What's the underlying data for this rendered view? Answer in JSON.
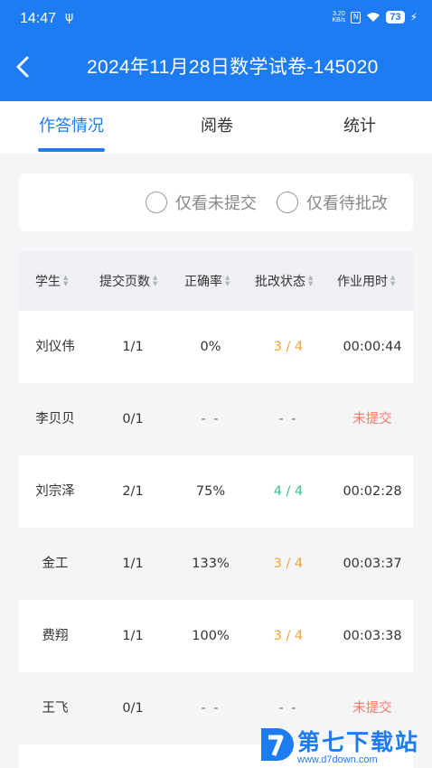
{
  "status_bar": {
    "time": "14:47",
    "usb_icon": "usb-icon",
    "net_speed_value": "3.20",
    "net_speed_unit": "KB/s",
    "battery": "73"
  },
  "header": {
    "title": "2024年11月28日数学试卷-145020",
    "background": "#1e7cf2"
  },
  "tabs": [
    {
      "label": "作答情况",
      "active": true
    },
    {
      "label": "阅卷",
      "active": false
    },
    {
      "label": "统计",
      "active": false
    }
  ],
  "filters": {
    "not_submitted": "仅看未提交",
    "pending_review": "仅看待批改"
  },
  "table": {
    "headers": [
      "学生",
      "提交页数",
      "正确率",
      "批改状态",
      "作业用时"
    ],
    "rows": [
      {
        "student": "刘仪伟",
        "pages": "1/1",
        "accuracy": "0%",
        "status": "3 / 4",
        "status_color": "orange",
        "time": "00:00:44",
        "time_color": "normal"
      },
      {
        "student": "李贝贝",
        "pages": "0/1",
        "accuracy": "- -",
        "status": "- -",
        "status_color": "dash",
        "time": "未提交",
        "time_color": "red"
      },
      {
        "student": "刘宗泽",
        "pages": "2/1",
        "accuracy": "75%",
        "status": "4 / 4",
        "status_color": "green",
        "time": "00:02:28",
        "time_color": "normal"
      },
      {
        "student": "金工",
        "pages": "1/1",
        "accuracy": "133%",
        "status": "3 / 4",
        "status_color": "orange",
        "time": "00:03:37",
        "time_color": "normal"
      },
      {
        "student": "费翔",
        "pages": "1/1",
        "accuracy": "100%",
        "status": "3 / 4",
        "status_color": "orange",
        "time": "00:03:38",
        "time_color": "normal"
      },
      {
        "student": "王飞",
        "pages": "0/1",
        "accuracy": "- -",
        "status": "- -",
        "status_color": "dash",
        "time": "未提交",
        "time_color": "red"
      }
    ]
  },
  "watermark": {
    "name": "第七下载站",
    "url": "www.d7down.com"
  },
  "colors": {
    "accent": "#1e7cf2",
    "orange": "#f0a33a",
    "green": "#3cc089",
    "red": "#f07a6a"
  }
}
